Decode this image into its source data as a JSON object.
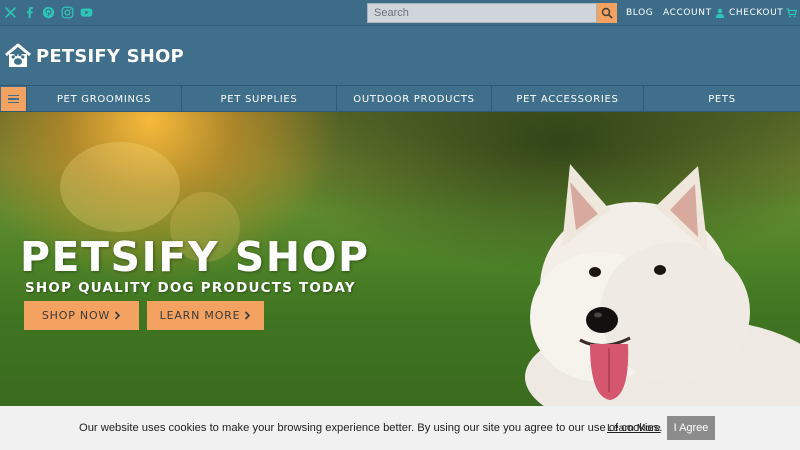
{
  "topbar": {
    "social_icons": [
      "x-icon",
      "facebook-icon",
      "pinterest-icon",
      "instagram-icon",
      "youtube-icon"
    ],
    "search_placeholder": "Search",
    "links": {
      "blog": "BLOG",
      "account": "ACCOUNT",
      "checkout": "CHECKOUT"
    }
  },
  "header": {
    "logo_text": "PETSIFY SHOP"
  },
  "nav": {
    "items": [
      "PET GROOMINGS",
      "PET SUPPLIES",
      "OUTDOOR PRODUCTS",
      "PET ACCESSORIES",
      "PETS"
    ]
  },
  "hero": {
    "title": "PETSIFY SHOP",
    "subtitle": "SHOP QUALITY DOG PRODUCTS TODAY",
    "buttons": {
      "shop_now": "SHOP NOW",
      "learn_more": "LEARN MORE"
    }
  },
  "cookie": {
    "text": "Our website uses cookies to make your browsing experience better. By using our site you agree to our use of cookies.",
    "link": "Learn More",
    "button": "I Agree"
  },
  "colors": {
    "brand_bar": "#3f6f8a",
    "accent": "#f4a261",
    "social_icon": "#2ec4b6",
    "cookie_bg": "#f1f1f1",
    "cookie_button": "#8c8c8c"
  }
}
